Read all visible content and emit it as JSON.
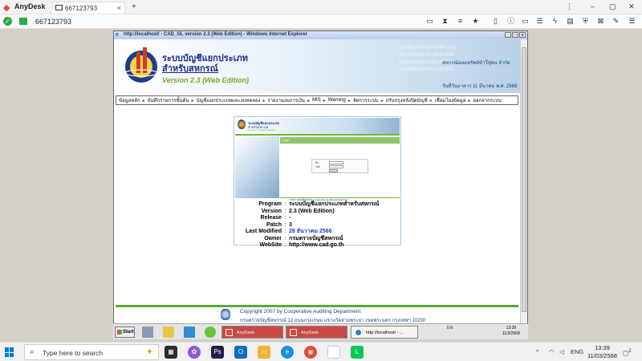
{
  "anydesk": {
    "app_name": "AnyDesk",
    "tab_label": "667123793",
    "tab_close": "×",
    "add_tab": "+",
    "address": "667123793",
    "wc_menu": "⋮",
    "wc_min": "–",
    "wc_max": "▢",
    "wc_close": "✕"
  },
  "ie": {
    "title": "http://localhost/ - CAD_GL version 2.3 (Web Edition) - Windows Internet Explorer",
    "buttons": [
      "_",
      "□",
      "x"
    ]
  },
  "banner": {
    "title": "ระบบบัญชีแยกประเภท",
    "subtitle": "สำหรับสหกรณ์",
    "version": "Version 2.3 (Web Edition)",
    "org": "สหกรณ์ออมทรัพย์ข้าวี่ปุ่ทน จำกัด",
    "date": "วันที่วันอาคาร 11 มีนาคม พ.ศ. 2568",
    "binary": [
      "10101101000110011101",
      "1011010011010011001",
      "0100110110110101011",
      "1101001101011101001"
    ]
  },
  "menu": [
    "ข้อมูลหลัก",
    "บันทึกรายการขั้นต้น",
    "บัญชีแยกประเภทและงบทดลอง",
    "รายงานงบการเงิน",
    "MIS",
    "Warning",
    "จัดการระบบ",
    "ปรับปรุงหลังปิดบัญชี",
    "เชื่อมโยงข้อมูล",
    "ออกจากระบบ"
  ],
  "login_box": {
    "head_title": "ระบบบัญชีแยกประเภท",
    "head_sub": "สำหรับสหกรณ์",
    "head_ver": "Version 2.3 (Web Edition)",
    "panel_title": "Login",
    "user_label": "ชื่อ",
    "pass_label": "รหัส",
    "footer": "กรมตรวจบัญชีสหกรณ์ Cooperative Auditing Department"
  },
  "info": [
    {
      "key": "Program",
      "value": "ระบบบัญชีแยกประเภทสำหรับสหกรณ์"
    },
    {
      "key": "Version",
      "value": "2.3 (Web Edition)"
    },
    {
      "key": "Release",
      "value": "-"
    },
    {
      "key": "Patch",
      "value": "3"
    },
    {
      "key": "Last Modified",
      "value": "28 ธันวาคม 2566"
    },
    {
      "key": "Owner",
      "value": "กรมตรวจบัญชีสหกรณ์"
    },
    {
      "key": "WebSite",
      "value": "http://www.cad.go.th"
    }
  ],
  "footer": {
    "copyright": "Copyright 2007 by Cooperative Auditing Department",
    "address": "กรมตรวจบัญชีสหกรณ์ 12 ถนนกรุงเกษม แขวงวัดสามพระยา เขตพระนคร กรุงเทพฯ 10200"
  },
  "xp_taskbar": {
    "start": "Start",
    "tasks": [
      "AnyDesk",
      "AnyDesk",
      "http://localhost/ - ..."
    ],
    "lang": "EN",
    "clock_time": "13:39",
    "clock_date": "11/3/2568"
  },
  "win_taskbar": {
    "search_placeholder": "Type here to search",
    "lang": "ENG",
    "time": "13:39",
    "date": "11/03/2568",
    "notif_count": "2"
  }
}
